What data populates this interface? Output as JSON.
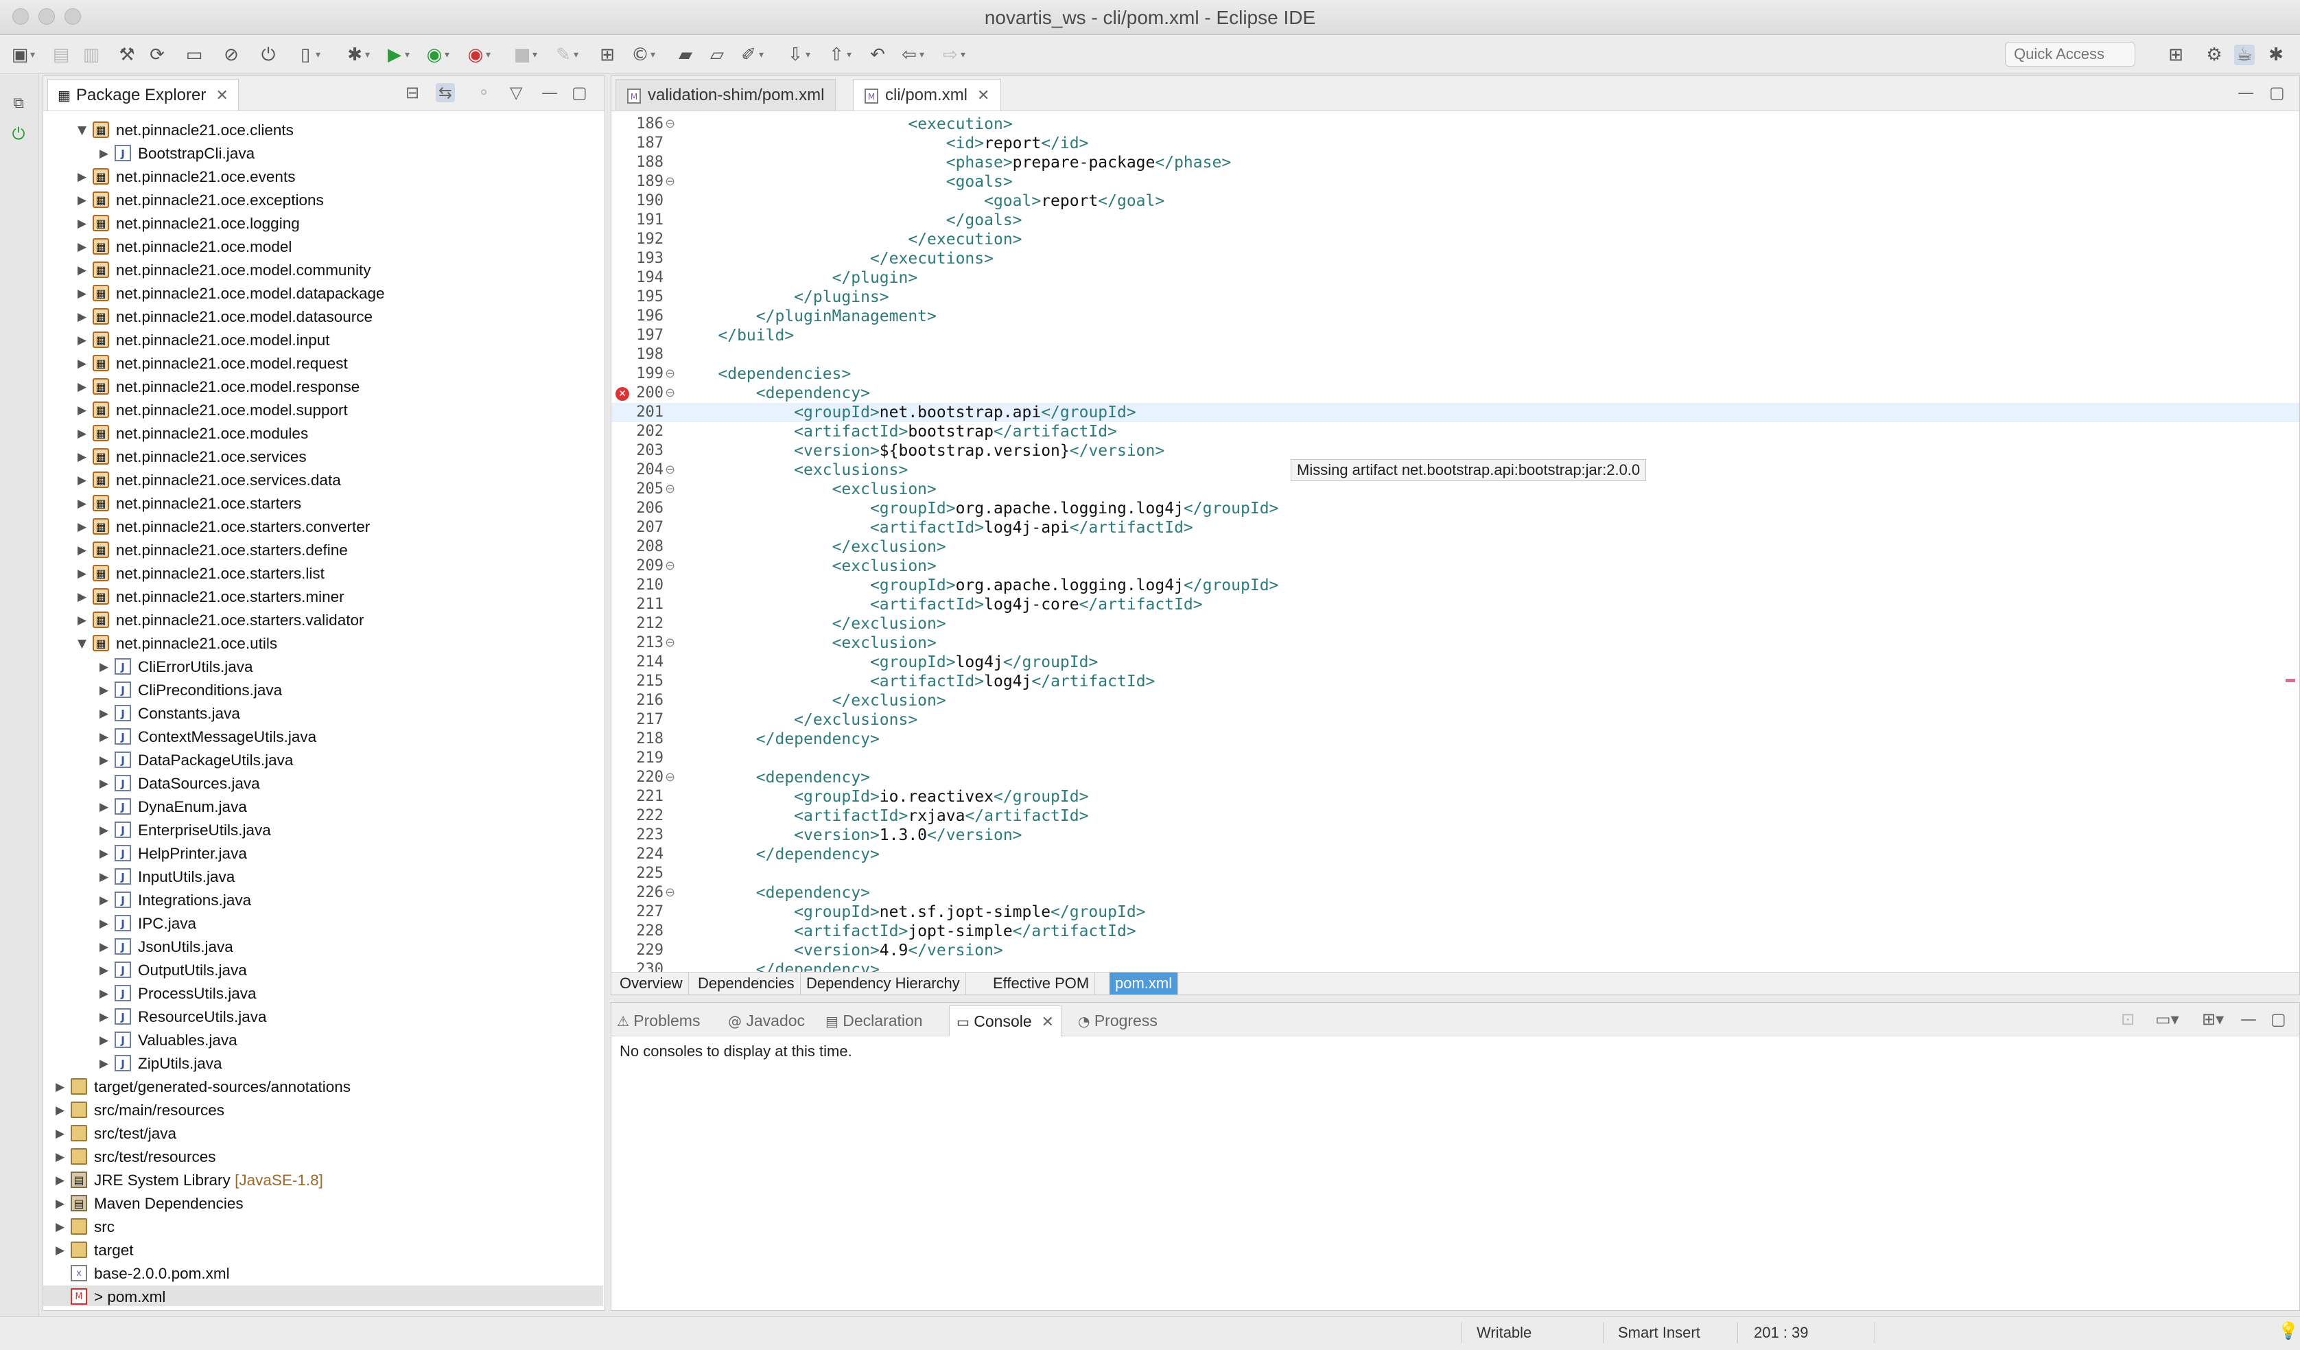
{
  "window": {
    "title": "novartis_ws - cli/pom.xml - Eclipse IDE"
  },
  "toolbar": {
    "quick_access_placeholder": "Quick Access"
  },
  "package_explorer": {
    "title": "Package Explorer",
    "items": [
      {
        "label": "net.pinnacle21.oce.clients",
        "type": "pkg",
        "level": 1,
        "expanded": true
      },
      {
        "label": "BootstrapCli.java",
        "type": "java",
        "level": 2,
        "expanded": false
      },
      {
        "label": "net.pinnacle21.oce.events",
        "type": "pkg",
        "level": 1,
        "expanded": false
      },
      {
        "label": "net.pinnacle21.oce.exceptions",
        "type": "pkg",
        "level": 1,
        "expanded": false
      },
      {
        "label": "net.pinnacle21.oce.logging",
        "type": "pkg",
        "level": 1,
        "expanded": false
      },
      {
        "label": "net.pinnacle21.oce.model",
        "type": "pkg",
        "level": 1,
        "expanded": false
      },
      {
        "label": "net.pinnacle21.oce.model.community",
        "type": "pkg",
        "level": 1,
        "expanded": false
      },
      {
        "label": "net.pinnacle21.oce.model.datapackage",
        "type": "pkg",
        "level": 1,
        "expanded": false
      },
      {
        "label": "net.pinnacle21.oce.model.datasource",
        "type": "pkg",
        "level": 1,
        "expanded": false
      },
      {
        "label": "net.pinnacle21.oce.model.input",
        "type": "pkg",
        "level": 1,
        "expanded": false
      },
      {
        "label": "net.pinnacle21.oce.model.request",
        "type": "pkg",
        "level": 1,
        "expanded": false
      },
      {
        "label": "net.pinnacle21.oce.model.response",
        "type": "pkg",
        "level": 1,
        "expanded": false
      },
      {
        "label": "net.pinnacle21.oce.model.support",
        "type": "pkg",
        "level": 1,
        "expanded": false
      },
      {
        "label": "net.pinnacle21.oce.modules",
        "type": "pkg",
        "level": 1,
        "expanded": false
      },
      {
        "label": "net.pinnacle21.oce.services",
        "type": "pkg",
        "level": 1,
        "expanded": false
      },
      {
        "label": "net.pinnacle21.oce.services.data",
        "type": "pkg",
        "level": 1,
        "expanded": false
      },
      {
        "label": "net.pinnacle21.oce.starters",
        "type": "pkg",
        "level": 1,
        "expanded": false
      },
      {
        "label": "net.pinnacle21.oce.starters.converter",
        "type": "pkg",
        "level": 1,
        "expanded": false
      },
      {
        "label": "net.pinnacle21.oce.starters.define",
        "type": "pkg",
        "level": 1,
        "expanded": false
      },
      {
        "label": "net.pinnacle21.oce.starters.list",
        "type": "pkg",
        "level": 1,
        "expanded": false
      },
      {
        "label": "net.pinnacle21.oce.starters.miner",
        "type": "pkg",
        "level": 1,
        "expanded": false
      },
      {
        "label": "net.pinnacle21.oce.starters.validator",
        "type": "pkg",
        "level": 1,
        "expanded": false
      },
      {
        "label": "net.pinnacle21.oce.utils",
        "type": "pkg",
        "level": 1,
        "expanded": true
      },
      {
        "label": "CliErrorUtils.java",
        "type": "java",
        "level": 2,
        "expanded": false
      },
      {
        "label": "CliPreconditions.java",
        "type": "java",
        "level": 2,
        "expanded": false
      },
      {
        "label": "Constants.java",
        "type": "java",
        "level": 2,
        "expanded": false
      },
      {
        "label": "ContextMessageUtils.java",
        "type": "java",
        "level": 2,
        "expanded": false
      },
      {
        "label": "DataPackageUtils.java",
        "type": "java",
        "level": 2,
        "expanded": false
      },
      {
        "label": "DataSources.java",
        "type": "java",
        "level": 2,
        "expanded": false
      },
      {
        "label": "DynaEnum.java",
        "type": "java",
        "level": 2,
        "expanded": false
      },
      {
        "label": "EnterpriseUtils.java",
        "type": "java",
        "level": 2,
        "expanded": false
      },
      {
        "label": "HelpPrinter.java",
        "type": "java",
        "level": 2,
        "expanded": false
      },
      {
        "label": "InputUtils.java",
        "type": "java",
        "level": 2,
        "expanded": false
      },
      {
        "label": "Integrations.java",
        "type": "java",
        "level": 2,
        "expanded": false
      },
      {
        "label": "IPC.java",
        "type": "java",
        "level": 2,
        "expanded": false
      },
      {
        "label": "JsonUtils.java",
        "type": "java",
        "level": 2,
        "expanded": false
      },
      {
        "label": "OutputUtils.java",
        "type": "java",
        "level": 2,
        "expanded": false
      },
      {
        "label": "ProcessUtils.java",
        "type": "java",
        "level": 2,
        "expanded": false
      },
      {
        "label": "ResourceUtils.java",
        "type": "java",
        "level": 2,
        "expanded": false
      },
      {
        "label": "Valuables.java",
        "type": "java",
        "level": 2,
        "expanded": false
      },
      {
        "label": "ZipUtils.java",
        "type": "java",
        "level": 2,
        "expanded": false
      },
      {
        "label": "target/generated-sources/annotations",
        "type": "folder",
        "level": 0,
        "expanded": false
      },
      {
        "label": "src/main/resources",
        "type": "folder",
        "level": 0,
        "expanded": false
      },
      {
        "label": "src/test/java",
        "type": "folder",
        "level": 0,
        "expanded": false
      },
      {
        "label": "src/test/resources",
        "type": "folder",
        "level": 0,
        "expanded": false
      },
      {
        "label": "JRE System Library",
        "suffix": " [JavaSE-1.8]",
        "type": "jar",
        "level": 0,
        "expanded": false
      },
      {
        "label": "Maven Dependencies",
        "type": "jar",
        "level": 0,
        "expanded": false
      },
      {
        "label": "src",
        "type": "folder",
        "level": 0,
        "expanded": false
      },
      {
        "label": "target",
        "type": "folder",
        "level": 0,
        "expanded": false
      },
      {
        "label": "base-2.0.0.pom.xml",
        "type": "xml",
        "level": 0,
        "leaf": true
      },
      {
        "label": "> pom.xml",
        "type": "pom",
        "level": 0,
        "leaf": true,
        "selected": true
      }
    ]
  },
  "editor": {
    "tabs": [
      {
        "label": "validation-shim/pom.xml",
        "active": false
      },
      {
        "label": "cli/pom.xml",
        "active": true
      }
    ],
    "hover_tooltip": "Missing artifact net.bootstrap.api:bootstrap:jar:2.0.0",
    "lines": [
      {
        "n": "186",
        "fold": true,
        "indent": 6,
        "parts": [
          [
            "t",
            "<execution>"
          ]
        ]
      },
      {
        "n": "187",
        "indent": 7,
        "parts": [
          [
            "t",
            "<id>"
          ],
          [
            "x",
            "report"
          ],
          [
            "t",
            "</id>"
          ]
        ]
      },
      {
        "n": "188",
        "indent": 7,
        "parts": [
          [
            "t",
            "<phase>"
          ],
          [
            "x",
            "prepare-package"
          ],
          [
            "t",
            "</phase>"
          ]
        ]
      },
      {
        "n": "189",
        "fold": true,
        "indent": 7,
        "parts": [
          [
            "t",
            "<goals>"
          ]
        ]
      },
      {
        "n": "190",
        "indent": 8,
        "parts": [
          [
            "t",
            "<goal>"
          ],
          [
            "x",
            "report"
          ],
          [
            "t",
            "</goal>"
          ]
        ]
      },
      {
        "n": "191",
        "indent": 7,
        "parts": [
          [
            "t",
            "</goals>"
          ]
        ]
      },
      {
        "n": "192",
        "indent": 6,
        "parts": [
          [
            "t",
            "</execution>"
          ]
        ]
      },
      {
        "n": "193",
        "indent": 5,
        "parts": [
          [
            "t",
            "</executions>"
          ]
        ]
      },
      {
        "n": "194",
        "indent": 4,
        "parts": [
          [
            "t",
            "</plugin>"
          ]
        ]
      },
      {
        "n": "195",
        "indent": 3,
        "parts": [
          [
            "t",
            "</plugins>"
          ]
        ]
      },
      {
        "n": "196",
        "indent": 2,
        "parts": [
          [
            "t",
            "</pluginManagement>"
          ]
        ]
      },
      {
        "n": "197",
        "indent": 1,
        "parts": [
          [
            "t",
            "</build>"
          ]
        ]
      },
      {
        "n": "198",
        "indent": 0,
        "parts": []
      },
      {
        "n": "199",
        "fold": true,
        "indent": 1,
        "parts": [
          [
            "t",
            "<dependencies>"
          ]
        ]
      },
      {
        "n": "200",
        "fold": true,
        "error": true,
        "indent": 2,
        "parts": [
          [
            "t",
            "<dependency>"
          ]
        ]
      },
      {
        "n": "201",
        "current": true,
        "indent": 3,
        "parts": [
          [
            "t",
            "<groupId>"
          ],
          [
            "x",
            "net.bootstrap.api"
          ],
          [
            "t",
            "</groupId>"
          ]
        ]
      },
      {
        "n": "202",
        "indent": 3,
        "parts": [
          [
            "t",
            "<artifactId>"
          ],
          [
            "x",
            "bootstrap"
          ],
          [
            "t",
            "</artifactId>"
          ]
        ]
      },
      {
        "n": "203",
        "indent": 3,
        "parts": [
          [
            "t",
            "<version>"
          ],
          [
            "x",
            "${bootstrap.version}"
          ],
          [
            "t",
            "</version>"
          ]
        ]
      },
      {
        "n": "204",
        "fold": true,
        "indent": 3,
        "parts": [
          [
            "t",
            "<exclusions>"
          ]
        ]
      },
      {
        "n": "205",
        "fold": true,
        "indent": 4,
        "parts": [
          [
            "t",
            "<exclusion>"
          ]
        ]
      },
      {
        "n": "206",
        "indent": 5,
        "parts": [
          [
            "t",
            "<groupId>"
          ],
          [
            "x",
            "org.apache.logging.log4j"
          ],
          [
            "t",
            "</groupId>"
          ]
        ]
      },
      {
        "n": "207",
        "indent": 5,
        "parts": [
          [
            "t",
            "<artifactId>"
          ],
          [
            "x",
            "log4j-api"
          ],
          [
            "t",
            "</artifactId>"
          ]
        ]
      },
      {
        "n": "208",
        "indent": 4,
        "parts": [
          [
            "t",
            "</exclusion>"
          ]
        ]
      },
      {
        "n": "209",
        "fold": true,
        "indent": 4,
        "parts": [
          [
            "t",
            "<exclusion>"
          ]
        ]
      },
      {
        "n": "210",
        "indent": 5,
        "parts": [
          [
            "t",
            "<groupId>"
          ],
          [
            "x",
            "org.apache.logging.log4j"
          ],
          [
            "t",
            "</groupId>"
          ]
        ]
      },
      {
        "n": "211",
        "indent": 5,
        "parts": [
          [
            "t",
            "<artifactId>"
          ],
          [
            "x",
            "log4j-core"
          ],
          [
            "t",
            "</artifactId>"
          ]
        ]
      },
      {
        "n": "212",
        "indent": 4,
        "parts": [
          [
            "t",
            "</exclusion>"
          ]
        ]
      },
      {
        "n": "213",
        "fold": true,
        "indent": 4,
        "parts": [
          [
            "t",
            "<exclusion>"
          ]
        ]
      },
      {
        "n": "214",
        "indent": 5,
        "parts": [
          [
            "t",
            "<groupId>"
          ],
          [
            "x",
            "log4j"
          ],
          [
            "t",
            "</groupId>"
          ]
        ]
      },
      {
        "n": "215",
        "indent": 5,
        "parts": [
          [
            "t",
            "<artifactId>"
          ],
          [
            "x",
            "log4j"
          ],
          [
            "t",
            "</artifactId>"
          ]
        ]
      },
      {
        "n": "216",
        "indent": 4,
        "parts": [
          [
            "t",
            "</exclusion>"
          ]
        ]
      },
      {
        "n": "217",
        "indent": 3,
        "parts": [
          [
            "t",
            "</exclusions>"
          ]
        ]
      },
      {
        "n": "218",
        "indent": 2,
        "parts": [
          [
            "t",
            "</dependency>"
          ]
        ]
      },
      {
        "n": "219",
        "indent": 0,
        "parts": []
      },
      {
        "n": "220",
        "fold": true,
        "indent": 2,
        "parts": [
          [
            "t",
            "<dependency>"
          ]
        ]
      },
      {
        "n": "221",
        "indent": 3,
        "parts": [
          [
            "t",
            "<groupId>"
          ],
          [
            "x",
            "io.reactivex"
          ],
          [
            "t",
            "</groupId>"
          ]
        ]
      },
      {
        "n": "222",
        "indent": 3,
        "parts": [
          [
            "t",
            "<artifactId>"
          ],
          [
            "x",
            "rxjava"
          ],
          [
            "t",
            "</artifactId>"
          ]
        ]
      },
      {
        "n": "223",
        "indent": 3,
        "parts": [
          [
            "t",
            "<version>"
          ],
          [
            "x",
            "1.3.0"
          ],
          [
            "t",
            "</version>"
          ]
        ]
      },
      {
        "n": "224",
        "indent": 2,
        "parts": [
          [
            "t",
            "</dependency>"
          ]
        ]
      },
      {
        "n": "225",
        "indent": 0,
        "parts": []
      },
      {
        "n": "226",
        "fold": true,
        "indent": 2,
        "parts": [
          [
            "t",
            "<dependency>"
          ]
        ]
      },
      {
        "n": "227",
        "indent": 3,
        "parts": [
          [
            "t",
            "<groupId>"
          ],
          [
            "x",
            "net.sf.jopt-simple"
          ],
          [
            "t",
            "</groupId>"
          ]
        ]
      },
      {
        "n": "228",
        "indent": 3,
        "parts": [
          [
            "t",
            "<artifactId>"
          ],
          [
            "x",
            "jopt-simple"
          ],
          [
            "t",
            "</artifactId>"
          ]
        ]
      },
      {
        "n": "229",
        "indent": 3,
        "parts": [
          [
            "t",
            "<version>"
          ],
          [
            "x",
            "4.9"
          ],
          [
            "t",
            "</version>"
          ]
        ]
      },
      {
        "n": "230",
        "indent": 2,
        "parts": [
          [
            "t",
            "</dependency>"
          ]
        ]
      }
    ],
    "pom_tabs": [
      {
        "label": "Overview",
        "active": false
      },
      {
        "label": "Dependencies",
        "active": false
      },
      {
        "label": "Dependency Hierarchy",
        "active": false
      },
      {
        "label": "Effective POM",
        "active": false
      },
      {
        "label": "pom.xml",
        "active": true
      }
    ]
  },
  "console": {
    "tabs": [
      {
        "label": "Problems",
        "active": false
      },
      {
        "label": "Javadoc",
        "active": false
      },
      {
        "label": "Declaration",
        "active": false
      },
      {
        "label": "Console",
        "active": true
      },
      {
        "label": "Progress",
        "active": false
      }
    ],
    "message": "No consoles to display at this time."
  },
  "status": {
    "writable": "Writable",
    "insert_mode": "Smart Insert",
    "position": "201 : 39"
  }
}
